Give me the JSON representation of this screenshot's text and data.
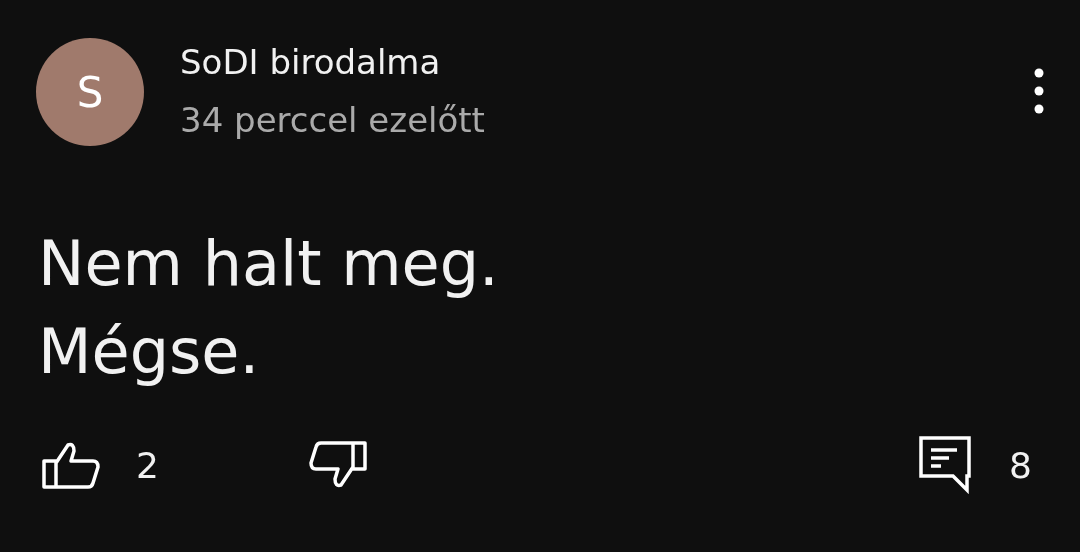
{
  "comment": {
    "avatar_letter": "S",
    "author": "SoDI birodalma",
    "time": "34 perccel ezelőtt",
    "text": "Nem halt meg.\nMégse.",
    "likes": "2",
    "replies": "8"
  }
}
